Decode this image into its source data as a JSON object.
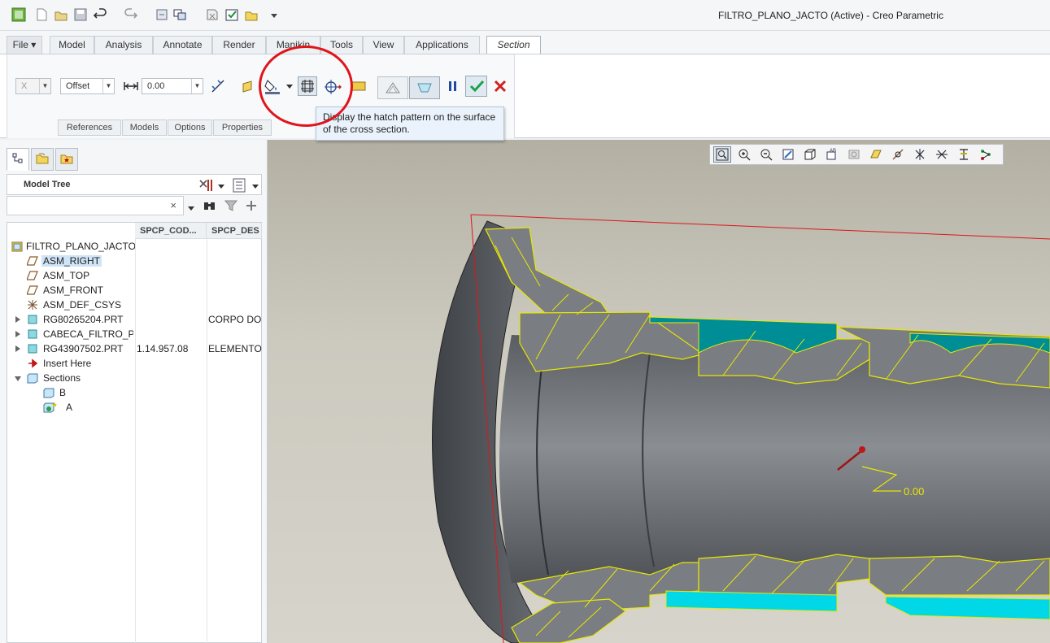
{
  "window": {
    "title": "FILTRO_PLANO_JACTO (Active) - Creo Parametric"
  },
  "quick_access": {
    "icons": [
      "app-logo-icon",
      "new-file-icon",
      "open-file-icon",
      "save-icon",
      "undo-icon",
      "redo-icon",
      "regenerate-icon",
      "windows-icon",
      "close-icon",
      "customize-icon"
    ]
  },
  "ribbon_tabs": [
    {
      "label": "File ▾"
    },
    {
      "label": "Model"
    },
    {
      "label": "Analysis"
    },
    {
      "label": "Annotate"
    },
    {
      "label": "Render"
    },
    {
      "label": "Manikin"
    },
    {
      "label": "Tools"
    },
    {
      "label": "View"
    },
    {
      "label": "Applications"
    },
    {
      "label": "Section"
    }
  ],
  "section_ribbon": {
    "axis_value": "X",
    "type_value": "Offset",
    "offset_value": "0.00",
    "subtabs": [
      "References",
      "Models",
      "Options",
      "Properties"
    ],
    "tooltip": "Display the hatch pattern on the surface of the cross section."
  },
  "model_tree": {
    "title": "Model Tree",
    "search_clear": "×",
    "columns": [
      "SPCP_COD...",
      "SPCP_DES"
    ],
    "items": [
      {
        "label": "FILTRO_PLANO_JACTO",
        "code": "",
        "desc": "",
        "icon": "assembly-icon"
      },
      {
        "label": "ASM_RIGHT",
        "code": "",
        "desc": "",
        "icon": "datum-plane-icon"
      },
      {
        "label": "ASM_TOP",
        "code": "",
        "desc": "",
        "icon": "datum-plane-icon"
      },
      {
        "label": "ASM_FRONT",
        "code": "",
        "desc": "",
        "icon": "datum-plane-icon"
      },
      {
        "label": "ASM_DEF_CSYS",
        "code": "",
        "desc": "",
        "icon": "csys-icon"
      },
      {
        "label": "RG80265204.PRT",
        "code": "",
        "desc": "CORPO DO",
        "icon": "part-icon"
      },
      {
        "label": "CABECA_FILTRO_P",
        "code": "",
        "desc": "",
        "icon": "part-icon"
      },
      {
        "label": "RG43907502.PRT",
        "code": "1.14.957.08",
        "desc": "ELEMENTO",
        "icon": "part-icon"
      },
      {
        "label": "Insert Here",
        "code": "",
        "desc": "",
        "icon": "insert-arrow-icon"
      },
      {
        "label": "Sections",
        "code": "",
        "desc": "",
        "icon": "sections-folder-icon"
      },
      {
        "label": "B",
        "code": "",
        "desc": "",
        "icon": "section-icon"
      },
      {
        "label": "A",
        "code": "",
        "desc": "",
        "icon": "section-active-icon"
      }
    ]
  },
  "viewport": {
    "dimension_label": "0.00",
    "view_toolbar_icons": [
      "refit-icon",
      "zoom-in-icon",
      "zoom-out-icon",
      "repaint-icon",
      "display-style-icon",
      "saved-views-icon",
      "view-manager-icon",
      "perspective-icon",
      "datum-display-icon",
      "annotation-display-icon",
      "spin-center-icon",
      "axis-display-icon",
      "csys-display-icon",
      "point-display-icon"
    ]
  },
  "colors": {
    "accent_check": "#1aa14a",
    "cancel": "#d21f1f",
    "highlight_circle": "#e0151b",
    "section_hatch": "#e8e800",
    "section_fill": "#00b8c8"
  }
}
